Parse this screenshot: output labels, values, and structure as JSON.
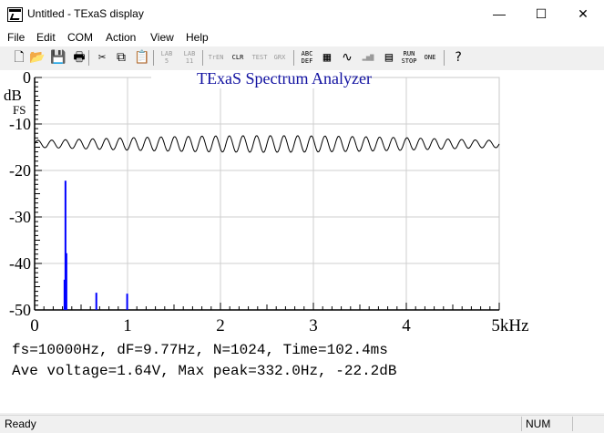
{
  "window": {
    "title": "Untitled - TExaS display",
    "minimize_icon": "minimize-icon",
    "maximize_icon": "maximize-icon",
    "close_icon": "close-icon"
  },
  "menu": [
    "File",
    "Edit",
    "COM",
    "Action",
    "View",
    "Help"
  ],
  "toolbar": [
    {
      "name": "new-icon",
      "glyph": "🗋"
    },
    {
      "name": "open-icon",
      "glyph": "📂"
    },
    {
      "name": "save-icon",
      "glyph": "💾"
    },
    {
      "name": "print-icon",
      "glyph": "🖶"
    },
    {
      "name": "cut-icon",
      "glyph": "✂"
    },
    {
      "name": "copy-icon",
      "glyph": "⧉"
    },
    {
      "name": "paste-icon",
      "glyph": "📋"
    },
    {
      "name": "lab5-icon",
      "glyph": "LAB\n5"
    },
    {
      "name": "lab11-icon",
      "glyph": "LAB\n11"
    },
    {
      "name": "tren-icon",
      "glyph": "TrEN"
    },
    {
      "name": "clear-icon",
      "glyph": "CLR"
    },
    {
      "name": "test-icon",
      "glyph": "TEST"
    },
    {
      "name": "grid-icon",
      "glyph": "GRX"
    },
    {
      "name": "abcdef-icon",
      "glyph": "ABC\nDEF"
    },
    {
      "name": "scope-icon",
      "glyph": "▦"
    },
    {
      "name": "waveform-icon",
      "glyph": "∿"
    },
    {
      "name": "spectrum-icon",
      "glyph": "▂▅▇"
    },
    {
      "name": "grid-wave-icon",
      "glyph": "▤"
    },
    {
      "name": "run-stop-icon",
      "glyph": "RUN\nSTOP"
    },
    {
      "name": "one-icon",
      "glyph": "ONE"
    },
    {
      "name": "help-icon",
      "glyph": "?"
    }
  ],
  "plot": {
    "title": "TExaS Spectrum Analyzer",
    "y_unit": "dB",
    "y_unit2": "FS",
    "x_unit": "kHz",
    "y_ticks": [
      "0",
      "-10",
      "-20",
      "-30",
      "-40",
      "-50"
    ],
    "x_ticks": [
      "0",
      "1",
      "2",
      "3",
      "4",
      "5kHz"
    ],
    "info_line1": "fs=10000Hz, dF=9.77Hz, N=1024, Time=102.4ms",
    "info_line2": "Ave voltage=1.64V, Max peak=332.0Hz, -22.2dB"
  },
  "chart_data": {
    "type": "bar",
    "title": "TExaS Spectrum Analyzer",
    "xlabel": "kHz",
    "ylabel": "dB FS",
    "xlim": [
      0,
      5
    ],
    "ylim": [
      -50,
      0
    ],
    "series": [
      {
        "name": "spectrum",
        "x": [
          0.322,
          0.332,
          0.342,
          0.664,
          0.996
        ],
        "values": [
          -43.5,
          -22.2,
          -37.8,
          -46.3,
          -46.5
        ]
      }
    ],
    "waveform": {
      "center_db": -14.3,
      "amplitude_db_max": 1.8,
      "cycles": 34
    },
    "colors": {
      "spectrum": "#0000ff",
      "axis": "#000000",
      "title": "#1010a0"
    }
  },
  "status": {
    "text": "Ready",
    "num": "NUM"
  }
}
